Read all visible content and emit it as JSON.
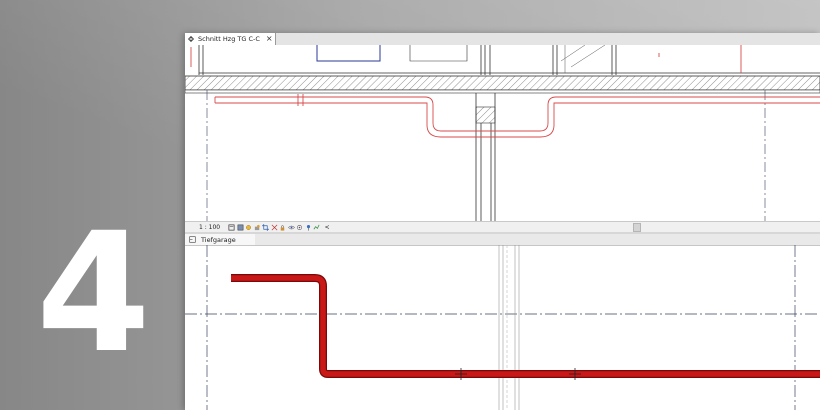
{
  "hero": {
    "number": "4"
  },
  "section_view": {
    "tab_title": "Schnitt Hzg TG C-C",
    "close_glyph": "×",
    "scale": "1 : 100",
    "scroll_glyph": "<"
  },
  "plan_view": {
    "tab_title": "Tiefgarage"
  },
  "icons": {
    "view_controls": [
      "page-icon",
      "visual-style-icon",
      "sun-path-icon",
      "shadows-icon",
      "crop-icon",
      "show-crop-icon",
      "lock-icon",
      "hide-icon",
      "eye-icon",
      "pin-icon",
      "analysis-icon"
    ]
  },
  "colors": {
    "pipe_thin": "#d84a4a",
    "pipe_thick": "#c01414",
    "gridline": "#3a4460",
    "window_line": "#2a3a9a"
  }
}
